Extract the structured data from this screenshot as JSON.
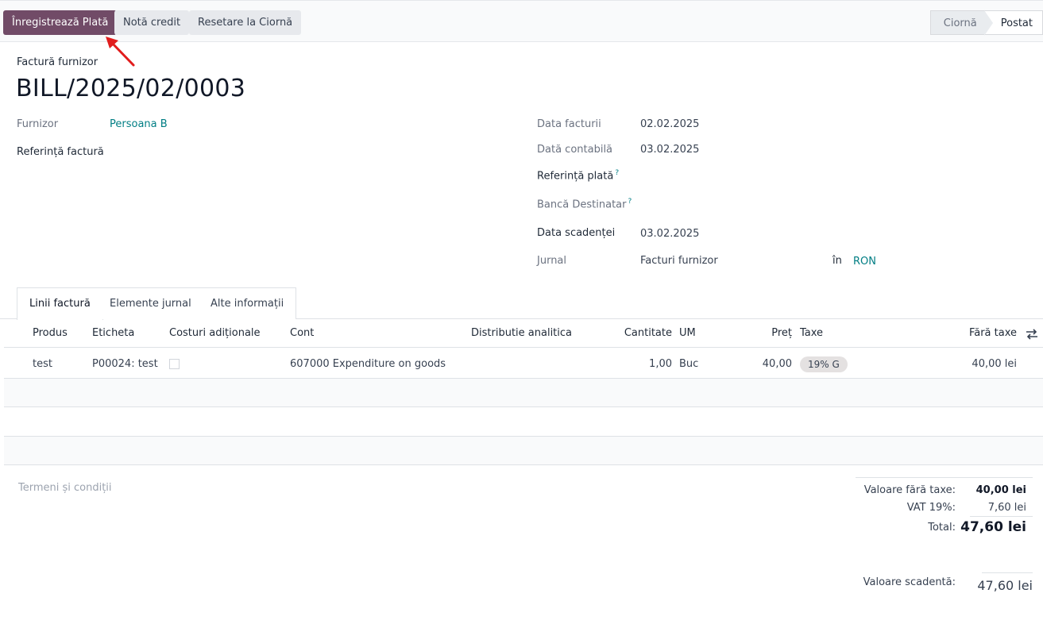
{
  "toolbar": {
    "register_payment": "Înregistrează Plată",
    "credit_note": "Notă credit",
    "reset_draft": "Resetare la Ciornă"
  },
  "status": {
    "draft": "Ciornă",
    "posted": "Postat"
  },
  "header": {
    "label": "Factură furnizor",
    "title": "BILL/2025/02/0003"
  },
  "fields": {
    "vendor_label": "Furnizor",
    "vendor_value": "Persoana B",
    "bill_ref_label": "Referință factură",
    "invoice_date_label": "Data facturii",
    "invoice_date_value": "02.02.2025",
    "accounting_date_label": "Dată contabilă",
    "accounting_date_value": "03.02.2025",
    "payment_ref_label": "Referință plată",
    "recipient_bank_label": "Bancă Destinatar",
    "due_date_label": "Data scadenței",
    "due_date_value": "03.02.2025",
    "journal_label": "Jurnal",
    "journal_value": "Facturi furnizor",
    "in_label": "în",
    "currency_value": "RON",
    "help_mark": "?"
  },
  "tabs": [
    {
      "label": "Linii factură"
    },
    {
      "label": "Elemente jurnal"
    },
    {
      "label": "Alte informații"
    }
  ],
  "table": {
    "headers": {
      "product": "Produs",
      "label": "Eticheta",
      "landed_costs": "Costuri adiționale",
      "account": "Cont",
      "analytic": "Distributie analitica",
      "quantity": "Cantitate",
      "uom": "UM",
      "price": "Preț",
      "taxes": "Taxe",
      "subtotal": "Fără taxe"
    },
    "rows": [
      {
        "product": "test",
        "label": "P00024: test",
        "account": "607000 Expenditure on goods",
        "quantity": "1,00",
        "uom": "Buc",
        "price": "40,00",
        "tax": "19% G",
        "subtotal": "40,00 lei"
      }
    ]
  },
  "footer": {
    "terms_placeholder": "Termeni și condiții",
    "untaxed_label": "Valoare fără taxe:",
    "untaxed_value": "40,00 lei",
    "vat_label": "VAT 19%:",
    "vat_value": "7,60 lei",
    "total_label": "Total:",
    "total_value": "47,60 lei",
    "amount_due_label": "Valoare scadentă:",
    "amount_due_value": "47,60 lei"
  },
  "colors": {
    "primary": "#714b67",
    "link": "#017e84",
    "arrow": "#e11d1d"
  }
}
